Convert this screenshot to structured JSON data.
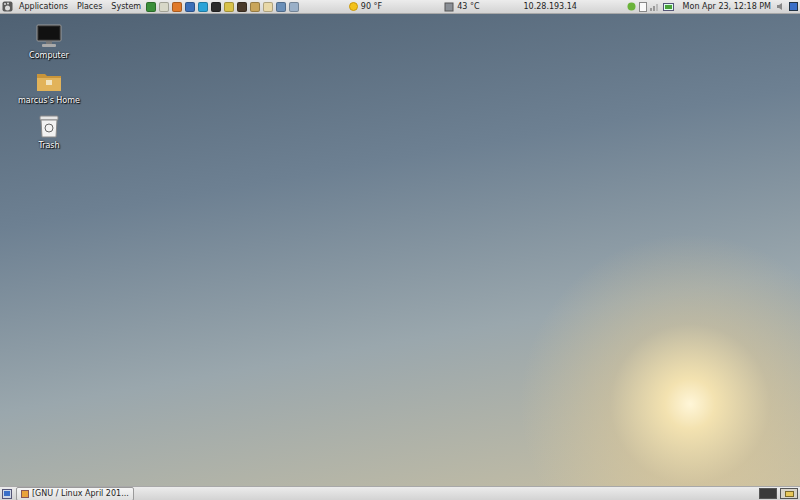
{
  "top_panel": {
    "menus": [
      "Applications",
      "Places",
      "System"
    ],
    "launchers": [
      {
        "color": "#3a8f3a"
      },
      {
        "color": "#d8d8c8"
      },
      {
        "color": "#e07a2a"
      },
      {
        "color": "#3b6fb8"
      },
      {
        "color": "#2aa3d8"
      },
      {
        "color": "#2b2b2b"
      },
      {
        "color": "#d9c24a"
      },
      {
        "color": "#4a3a2a"
      },
      {
        "color": "#c9a55a"
      },
      {
        "color": "#e8d8a8"
      },
      {
        "color": "#6a8fb8"
      },
      {
        "color": "#9ab0c8"
      }
    ],
    "weather": "90 °F",
    "temperature": "43 °C",
    "ip": "10.28.193.14",
    "clock": "Mon Apr 23, 12:18 PM"
  },
  "desktop_icons": [
    {
      "label": "Computer",
      "kind": "computer"
    },
    {
      "label": "marcus's Home",
      "kind": "folder"
    },
    {
      "label": "Trash",
      "kind": "trash"
    }
  ],
  "taskbar": {
    "windows": [
      {
        "title": "[GNU / Linux April 201...",
        "selected": false
      }
    ]
  },
  "workspaces": [
    {
      "selected": false
    },
    {
      "selected": true
    }
  ]
}
